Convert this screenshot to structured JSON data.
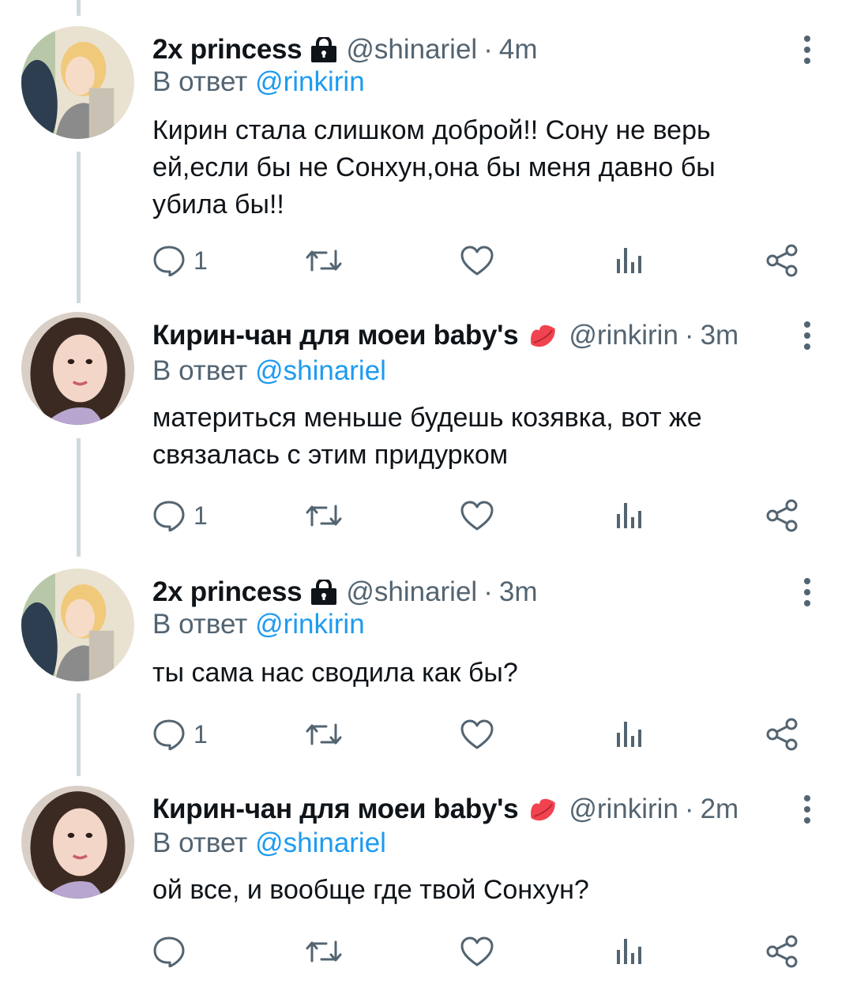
{
  "icons": {
    "lock": "lock-icon",
    "lips": "lips-icon",
    "more": "more-vertical-icon",
    "reply": "reply-icon",
    "retweet": "retweet-icon",
    "like": "heart-icon",
    "views": "views-icon",
    "share": "share-icon"
  },
  "colors": {
    "mention": "#1d9bf0",
    "secondary_text": "#536471",
    "thread_line": "#cfd9de",
    "lips": "#f0434f"
  },
  "tweets": [
    {
      "name": "2x princess",
      "handle": "@shinariel",
      "separator": "·",
      "time": "4m",
      "reply_prefix": "В ответ",
      "reply_to": "@rinkirin",
      "text": "Кирин стала слишком доброй!! Сону не верь ей,если бы не Сонхун,она бы меня давно бы убила бы!!",
      "reply_count": "1"
    },
    {
      "name": "Кирин-чан для моеи baby's",
      "handle": "@rinkirin",
      "separator": "·",
      "time": "3m",
      "reply_prefix": "В ответ",
      "reply_to": "@shinariel",
      "text": "материться меньше будешь козявка, вот же связалась с этим придурком",
      "reply_count": "1"
    },
    {
      "name": "2x princess",
      "handle": "@shinariel",
      "separator": "·",
      "time": "3m",
      "reply_prefix": "В ответ",
      "reply_to": "@rinkirin",
      "text": "ты сама нас сводила как бы?",
      "reply_count": "1"
    },
    {
      "name": "Кирин-чан для моеи baby's",
      "handle": "@rinkirin",
      "separator": "·",
      "time": "2m",
      "reply_prefix": "В ответ",
      "reply_to": "@shinariel",
      "text": "ой все, и вообще где твой Сонхун?",
      "reply_count": ""
    }
  ]
}
